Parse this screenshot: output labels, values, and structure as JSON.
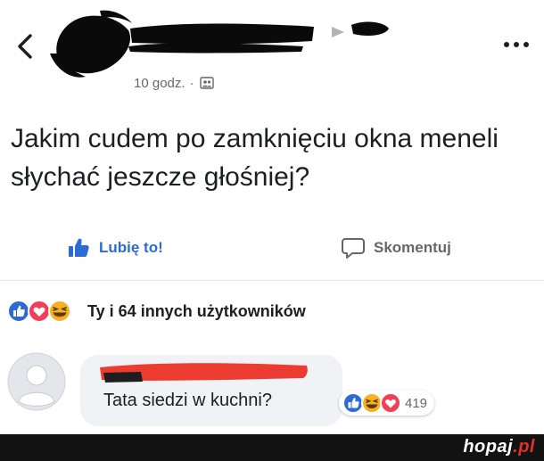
{
  "post": {
    "time": "10 godz.",
    "separator": "·",
    "text": "Jakim cudem po zamknięciu okna meneli słychać jeszcze głośniej?"
  },
  "actions": {
    "like_label": "Lubię to!",
    "comment_label": "Skomentuj"
  },
  "reactions_summary": {
    "text": "Ty i 64 innych użytkowników"
  },
  "comment": {
    "text": "Tata siedzi w kuchni?",
    "reaction_count": "419"
  },
  "watermark": {
    "site": "hopaj",
    "tld": ".pl"
  },
  "colors": {
    "like_blue": "#2d6bd4",
    "love_red": "#f33e58",
    "haha_yellow": "#f7b125",
    "redaction": "#0a0a0a",
    "redaction_red": "#ec3b30",
    "footer_bg": "#121212"
  }
}
